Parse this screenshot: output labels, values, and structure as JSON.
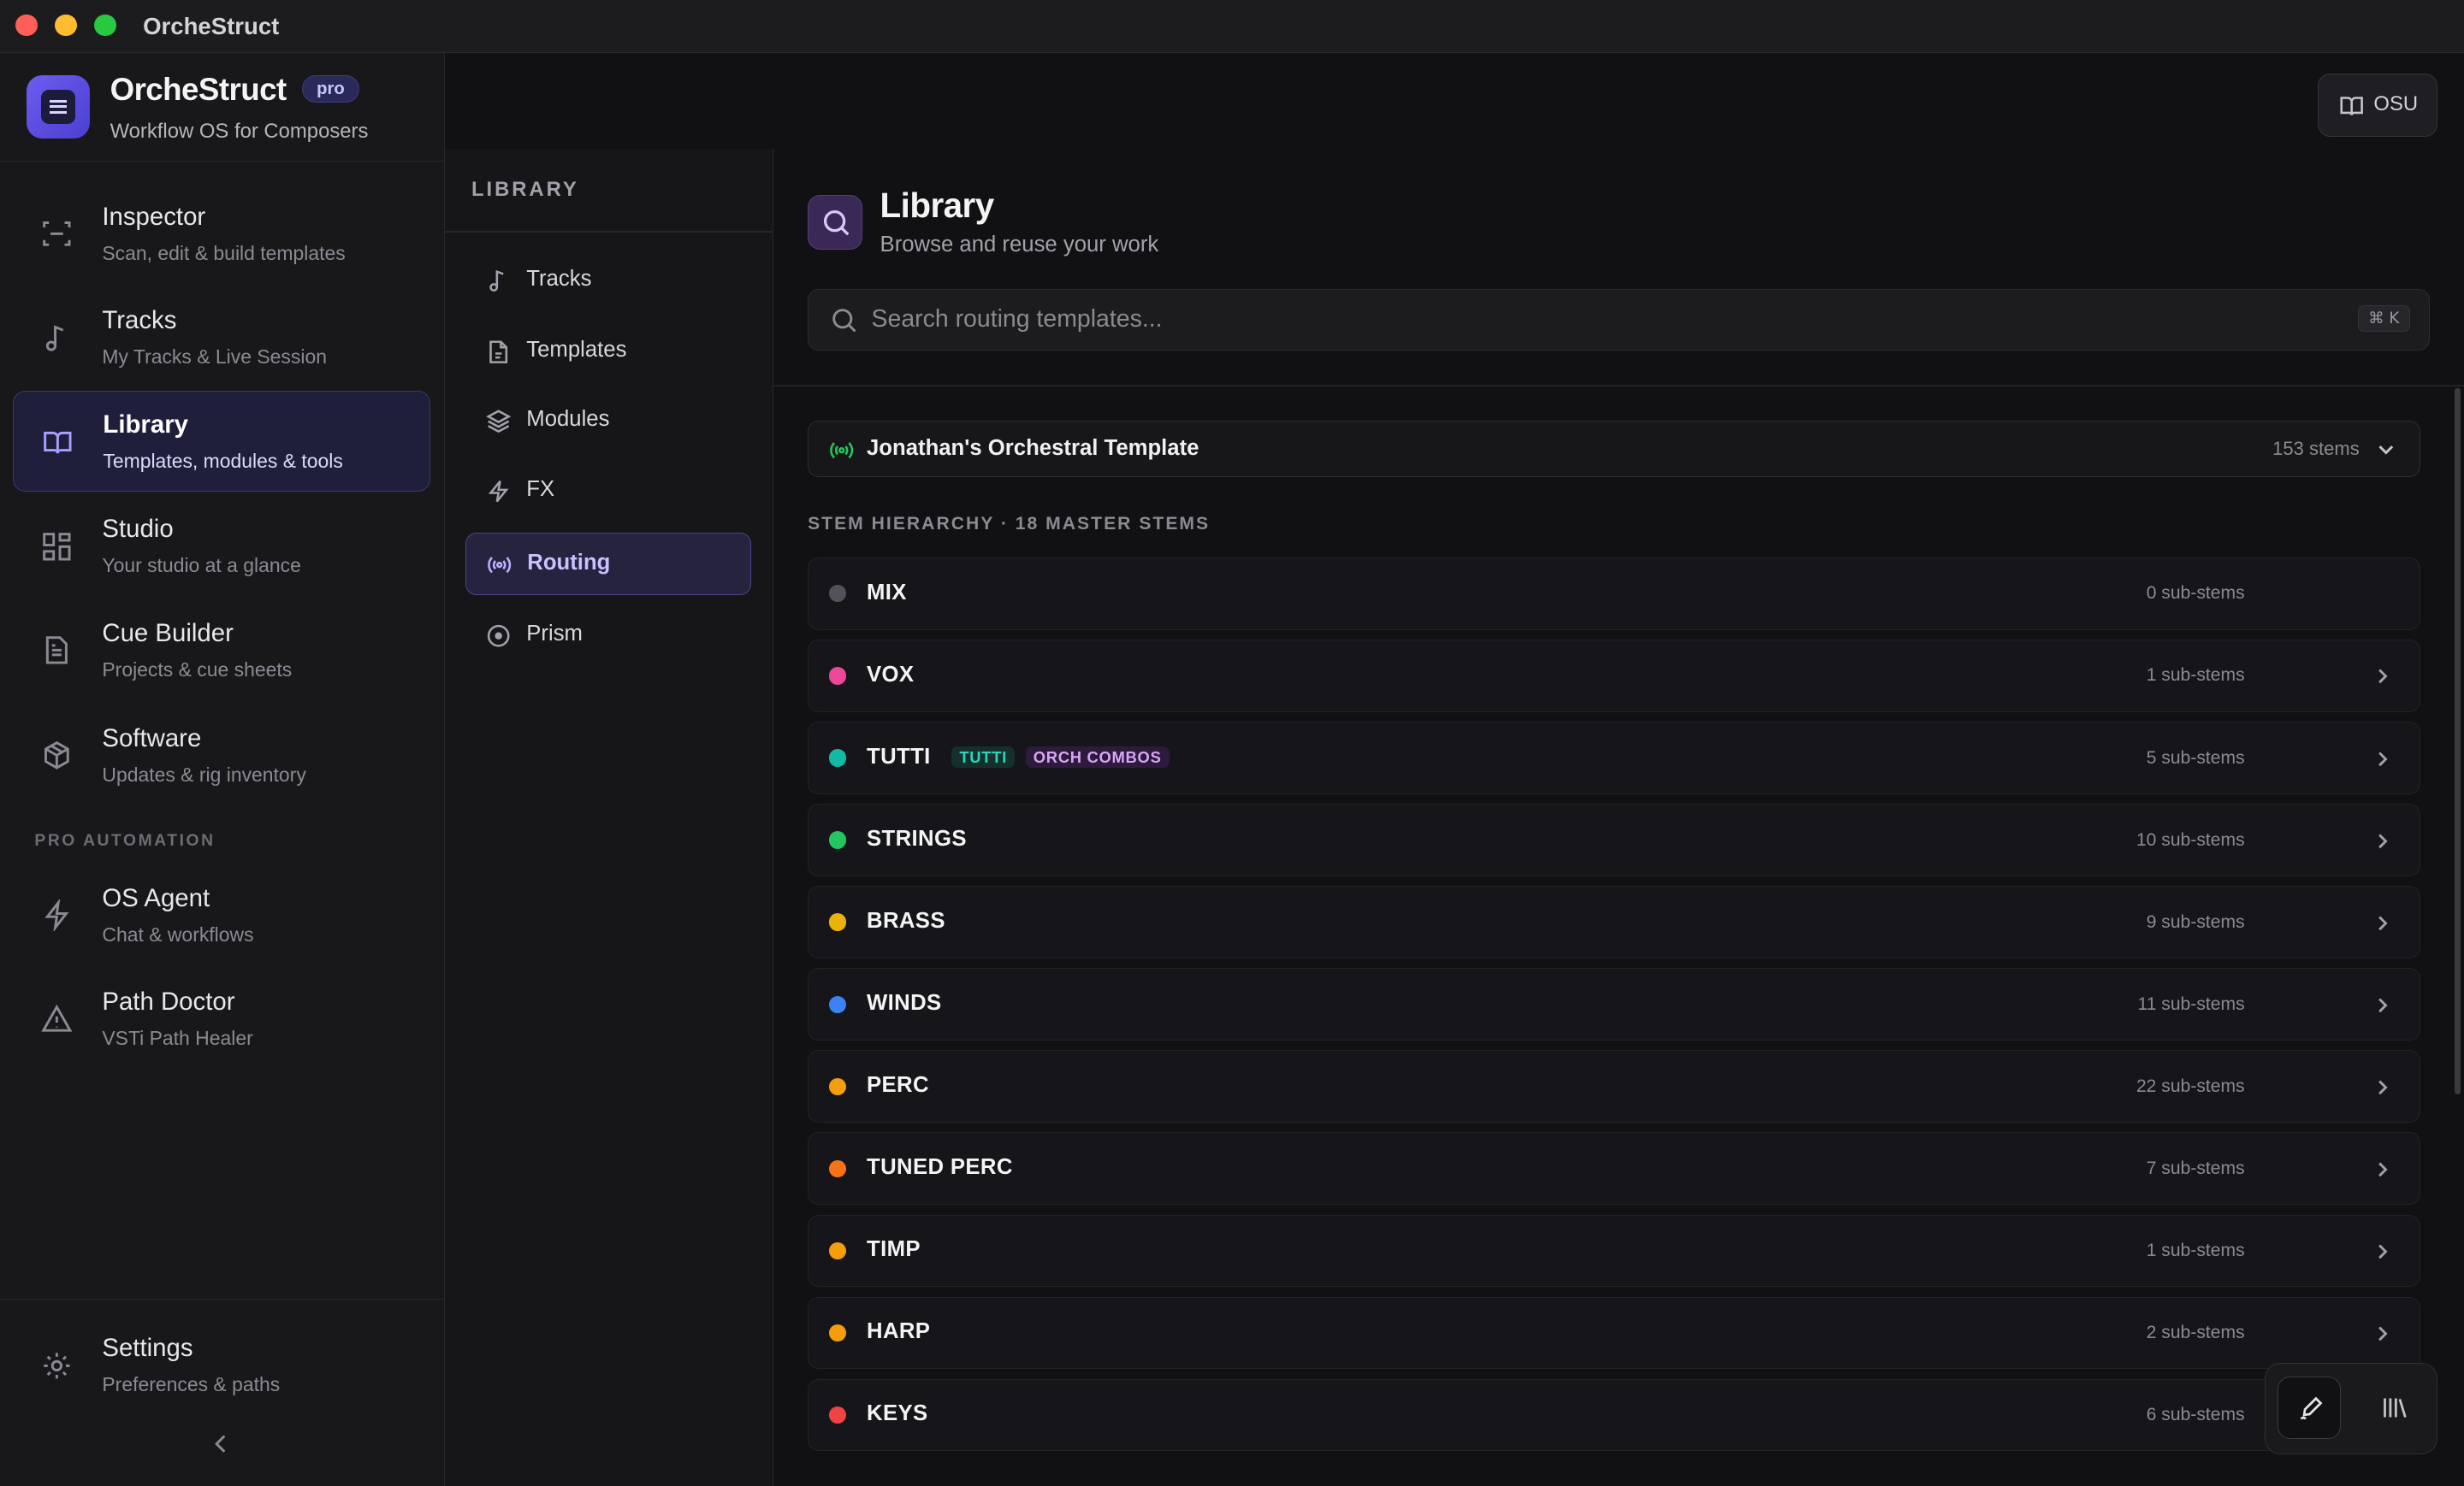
{
  "window": {
    "title": "OrcheStruct"
  },
  "brand": {
    "name": "OrcheStruct",
    "badge": "pro",
    "tagline": "Workflow OS for Composers"
  },
  "sidebar": {
    "items": [
      {
        "label": "Inspector",
        "sub": "Scan, edit & build templates",
        "icon": "scan-icon"
      },
      {
        "label": "Tracks",
        "sub": "My Tracks & Live Session",
        "icon": "music-note-icon"
      },
      {
        "label": "Library",
        "sub": "Templates, modules & tools",
        "icon": "book-icon",
        "active": true
      },
      {
        "label": "Studio",
        "sub": "Your studio at a glance",
        "icon": "grid-icon"
      },
      {
        "label": "Cue Builder",
        "sub": "Projects & cue sheets",
        "icon": "document-icon"
      },
      {
        "label": "Software",
        "sub": "Updates & rig inventory",
        "icon": "package-icon"
      }
    ],
    "section_header": "PRO AUTOMATION",
    "pro_items": [
      {
        "label": "OS Agent",
        "sub": "Chat & workflows",
        "icon": "bolt-icon"
      },
      {
        "label": "Path Doctor",
        "sub": "VSTi Path Healer",
        "icon": "warning-icon"
      }
    ],
    "settings": {
      "label": "Settings",
      "sub": "Preferences & paths",
      "icon": "gear-icon"
    }
  },
  "subnav": {
    "header": "LIBRARY",
    "items": [
      {
        "label": "Tracks",
        "icon": "music-note-icon"
      },
      {
        "label": "Templates",
        "icon": "file-icon"
      },
      {
        "label": "Modules",
        "icon": "layers-icon"
      },
      {
        "label": "FX",
        "icon": "bolt-icon"
      },
      {
        "label": "Routing",
        "icon": "broadcast-icon",
        "active": true
      },
      {
        "label": "Prism",
        "icon": "target-icon"
      }
    ]
  },
  "topbar": {
    "osu_label": "OSU"
  },
  "main": {
    "title": "Library",
    "subtitle": "Browse and reuse your work",
    "search": {
      "placeholder": "Search routing templates...",
      "shortcut": "⌘ K"
    },
    "template": {
      "name": "Jonathan's Orchestral Template",
      "count": "153 stems"
    },
    "hierarchy_label": "STEM HIERARCHY · 18 MASTER STEMS",
    "stems": [
      {
        "name": "MIX",
        "count": "0 sub-stems",
        "color": "#52525b",
        "chevron": false
      },
      {
        "name": "VOX",
        "count": "1 sub-stems",
        "color": "#ec4899",
        "chevron": true
      },
      {
        "name": "TUTTI",
        "count": "5 sub-stems",
        "color": "#14b8a6",
        "chevron": true,
        "tags": [
          "TUTTI",
          "ORCH COMBOS"
        ]
      },
      {
        "name": "STRINGS",
        "count": "10 sub-stems",
        "color": "#22c55e",
        "chevron": true
      },
      {
        "name": "BRASS",
        "count": "9 sub-stems",
        "color": "#eab308",
        "chevron": true
      },
      {
        "name": "WINDS",
        "count": "11 sub-stems",
        "color": "#3b82f6",
        "chevron": true
      },
      {
        "name": "PERC",
        "count": "22 sub-stems",
        "color": "#f59e0b",
        "chevron": true
      },
      {
        "name": "TUNED PERC",
        "count": "7 sub-stems",
        "color": "#f97316",
        "chevron": true
      },
      {
        "name": "TIMP",
        "count": "1 sub-stems",
        "color": "#f59e0b",
        "chevron": true
      },
      {
        "name": "HARP",
        "count": "2 sub-stems",
        "color": "#f59e0b",
        "chevron": true
      },
      {
        "name": "KEYS",
        "count": "6 sub-stems",
        "color": "#ef4444",
        "chevron": true
      }
    ]
  },
  "colors": {
    "accent": "#6d5cf0",
    "active_bg": "#1f1f3c",
    "routing_active": "#c7c2ff"
  }
}
